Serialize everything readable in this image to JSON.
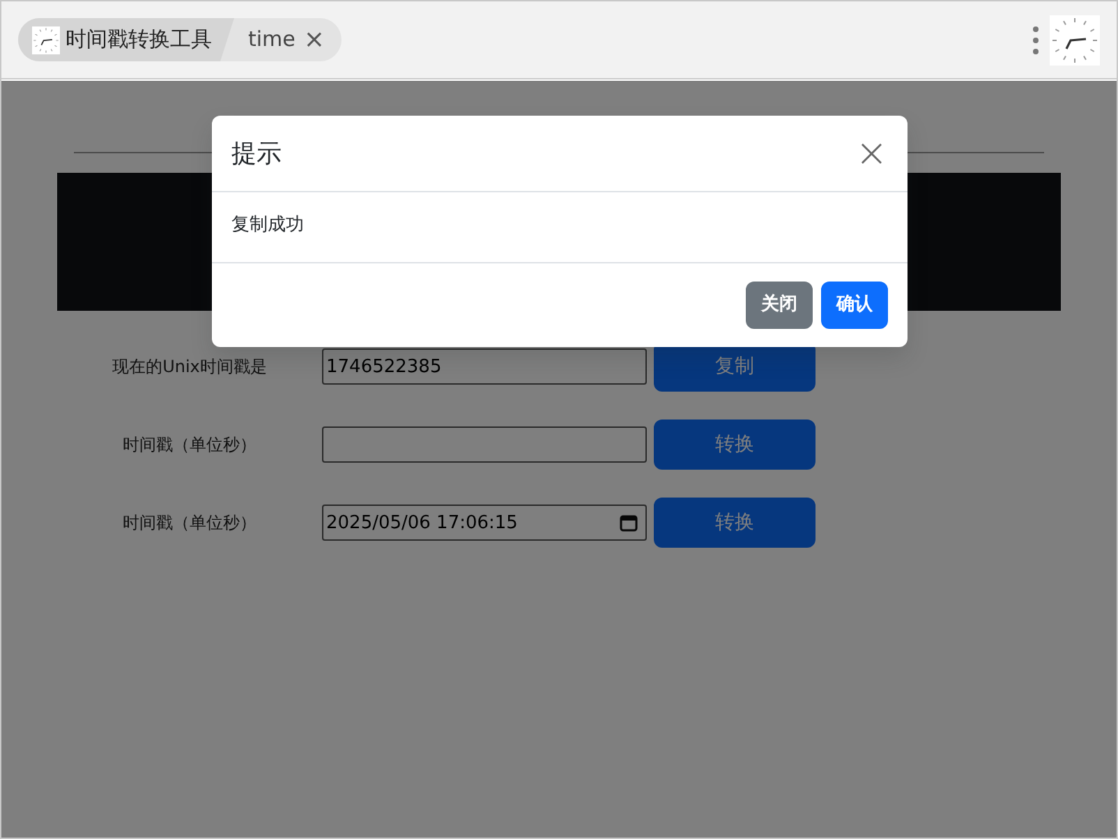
{
  "tabs": [
    {
      "label": "时间戳转换工具",
      "selected": true
    },
    {
      "label": "time",
      "selected": false,
      "close": "×"
    }
  ],
  "page": {
    "rows": [
      {
        "label": "现在的Unix时间戳是",
        "value": "1746522385",
        "kind": "text",
        "button": "复制"
      },
      {
        "label": "时间戳（单位秒）",
        "value": "",
        "kind": "text",
        "button": "转换"
      },
      {
        "label": "时间戳（单位秒）",
        "value": "2025/05/06 17:06:15",
        "kind": "date",
        "button": "转换"
      }
    ]
  },
  "dialog": {
    "title": "提示",
    "close": "×",
    "message": "复制成功",
    "buttons": [
      {
        "label": "关闭",
        "kind": "secondary"
      },
      {
        "label": "确认",
        "kind": "primary"
      }
    ]
  }
}
